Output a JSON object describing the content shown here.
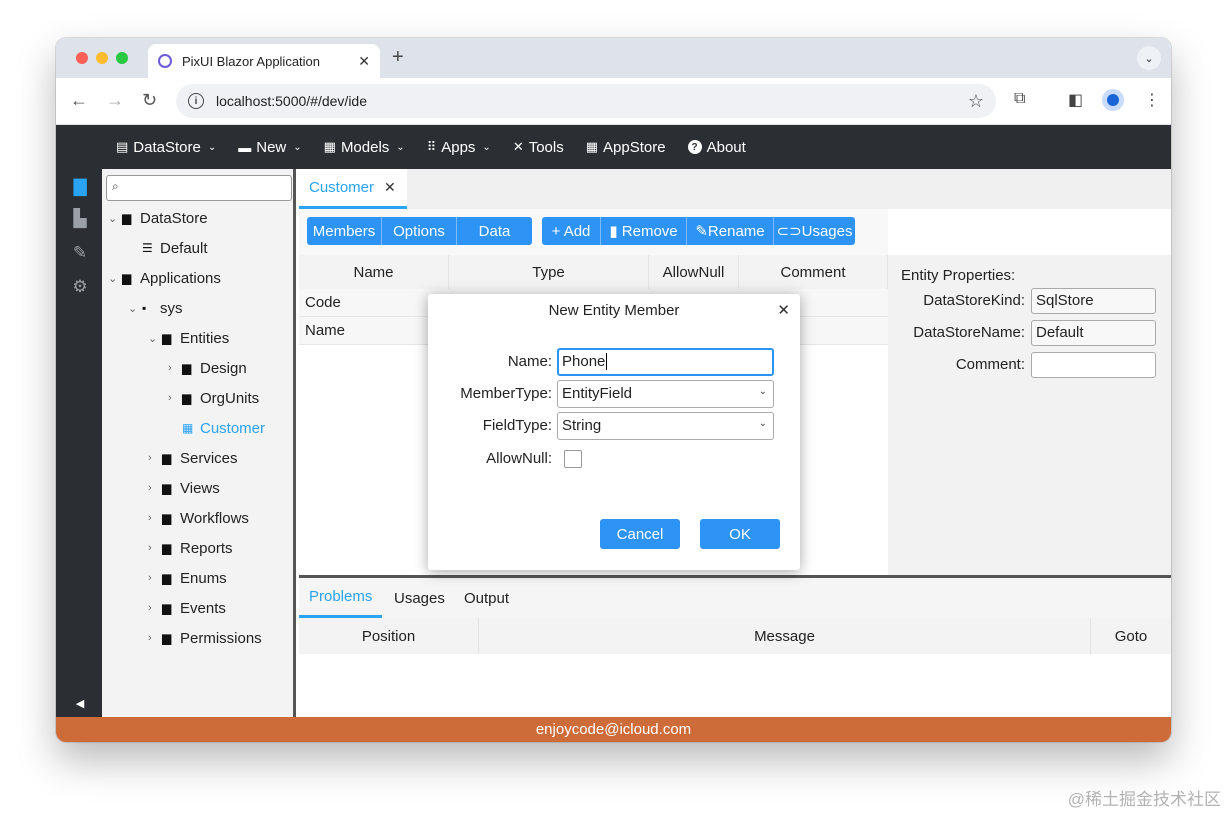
{
  "browser": {
    "tab_title": "PixUI Blazor Application",
    "tab_close": "✕",
    "new_tab": "+",
    "tab_menu": "⌄",
    "url": "localhost:5000/#/dev/ide",
    "back": "←",
    "forward": "→",
    "reload": "↻",
    "info": "i",
    "bookmark": "☆",
    "extensions": "⧉",
    "sidepanel": "◧",
    "menu": "⋮"
  },
  "appnav": [
    {
      "icon": "▤",
      "label": "DataStore",
      "caret": "⌄"
    },
    {
      "icon": "▬",
      "label": "New",
      "caret": "⌄"
    },
    {
      "icon": "▦",
      "label": "Models",
      "caret": "⌄"
    },
    {
      "icon": "⠿",
      "label": "Apps",
      "caret": "⌄"
    },
    {
      "icon": "✕",
      "label": "Tools",
      "caret": ""
    },
    {
      "icon": "▦",
      "label": "AppStore",
      "caret": ""
    },
    {
      "icon": "?",
      "label": "About",
      "caret": ""
    }
  ],
  "rail": {
    "icons": [
      "▇",
      "▙",
      "✎",
      "⚙"
    ],
    "collapse": "◀"
  },
  "tree": {
    "search_icon": "⌕",
    "items": [
      {
        "arrow": "⌄",
        "icon": "▆",
        "label": "DataStore"
      },
      {
        "arrow": "",
        "icon": "☰",
        "label": "Default"
      },
      {
        "arrow": "⌄",
        "icon": "▆",
        "label": "Applications"
      },
      {
        "arrow": "⌄",
        "icon": "▪",
        "label": "sys"
      },
      {
        "arrow": "⌄",
        "icon": "▆",
        "label": "Entities"
      },
      {
        "arrow": "›",
        "icon": "▆",
        "label": "Design"
      },
      {
        "arrow": "›",
        "icon": "▆",
        "label": "OrgUnits"
      },
      {
        "arrow": "",
        "icon": "▦",
        "label": "Customer"
      },
      {
        "arrow": "›",
        "icon": "▆",
        "label": "Services"
      },
      {
        "arrow": "›",
        "icon": "▆",
        "label": "Views"
      },
      {
        "arrow": "›",
        "icon": "▆",
        "label": "Workflows"
      },
      {
        "arrow": "›",
        "icon": "▆",
        "label": "Reports"
      },
      {
        "arrow": "›",
        "icon": "▆",
        "label": "Enums"
      },
      {
        "arrow": "›",
        "icon": "▆",
        "label": "Events"
      },
      {
        "arrow": "›",
        "icon": "▆",
        "label": "Permissions"
      }
    ]
  },
  "editor": {
    "doc_tab": "Customer",
    "doc_tab_close": "✕",
    "view_buttons": [
      "Members",
      "Options",
      "Data"
    ],
    "action_buttons": [
      "+ Add",
      "▮ Remove",
      "✎Rename",
      "⊂⊃Usages"
    ],
    "columns": [
      "Name",
      "Type",
      "AllowNull",
      "Comment"
    ],
    "rows": [
      "Code",
      "Name"
    ]
  },
  "properties": {
    "title": "Entity Properties:",
    "fields": [
      {
        "label": "DataStoreKind:",
        "value": "SqlStore"
      },
      {
        "label": "DataStoreName:",
        "value": "Default"
      },
      {
        "label": "Comment:",
        "value": ""
      }
    ]
  },
  "bottom": {
    "tabs": [
      "Problems",
      "Usages",
      "Output"
    ],
    "columns": [
      "Position",
      "Message",
      "Goto"
    ]
  },
  "footer": "enjoycode@icloud.com",
  "dialog": {
    "title": "New Entity Member",
    "close": "✕",
    "name_label": "Name:",
    "name_value": "Phone",
    "member_type_label": "MemberType:",
    "member_type_value": "EntityField",
    "field_type_label": "FieldType:",
    "field_type_value": "String",
    "allow_null_label": "AllowNull:",
    "allow_null_checked": false,
    "select_caret": "⌄",
    "cancel": "Cancel",
    "ok": "OK"
  },
  "watermark": "@稀土掘金技术社区",
  "colors": {
    "accent": "#2d93f5",
    "selected": "#29a3f2",
    "dark_bar": "#2b2f33",
    "footer": "#cd6b39"
  }
}
